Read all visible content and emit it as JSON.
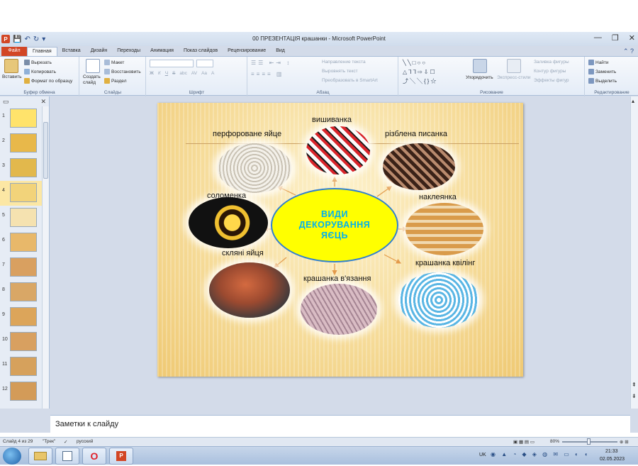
{
  "window": {
    "title": "00 ПРЕЗЕНТАЦІЯ крашанки - Microsoft PowerPoint",
    "app_letter": "P",
    "controls": [
      "—",
      "❐",
      "✕"
    ]
  },
  "tabs": {
    "file": "Файл",
    "items": [
      "Главная",
      "Вставка",
      "Дизайн",
      "Переходы",
      "Анимация",
      "Показ слайдов",
      "Рецензирование",
      "Вид"
    ]
  },
  "ribbon": {
    "clipboard": {
      "paste": "Вставить",
      "cut": "Вырезать",
      "copy": "Копировать",
      "format_painter": "Формат по образцу",
      "name": "Буфер обмена"
    },
    "slides": {
      "new_slide": "Создать слайд",
      "layout": "Макет",
      "reset": "Восстановить",
      "section": "Раздел",
      "name": "Слайды"
    },
    "font": {
      "name": "Шрифт",
      "bold": "Ж",
      "italic": "К",
      "underline": "Ч",
      "strike": "S",
      "shadow": "abc",
      "spacing": "AV",
      "case": "Aa",
      "color": "A"
    },
    "paragraph": {
      "direction": "Направление текста",
      "align": "Выровнять текст",
      "smartart": "Преобразовать в SmartArt",
      "name": "Абзац"
    },
    "drawing": {
      "shapes": "╲╲□○○\n△⅂⅂⇨⇩☐\n⤴╲╲{}☆",
      "arrange": "Упорядочить",
      "quick_styles": "Экспресс-стили",
      "fill": "Заливка фигуры",
      "outline": "Контур фигуры",
      "effects": "Эффекты фигур",
      "name": "Рисование"
    },
    "editing": {
      "find": "Найти",
      "replace": "Заменить",
      "select": "Выделить",
      "name": "Редактирование"
    }
  },
  "thumbnails": {
    "numbers": [
      "1",
      "2",
      "3",
      "4",
      "5",
      "6",
      "7",
      "8",
      "9",
      "10",
      "11",
      "12"
    ],
    "selected": 4,
    "colors": [
      "#ffe36b",
      "#e8b84a",
      "#e2b84c",
      "#f2d37a",
      "#f5e2b0",
      "#e8b86a",
      "#d9a060",
      "#d9a766",
      "#dca55a",
      "#d8a060",
      "#d6a15c",
      "#d39b58"
    ]
  },
  "slide": {
    "center_title": [
      "ВИДИ",
      "ДЕКОРУВАННЯ",
      "ЯЄЦЬ"
    ],
    "labels": {
      "perforated": "перфороване яйце",
      "embroidered": "вишиванка",
      "carved": "різблена писанка",
      "straw": "соломенка",
      "sticker": "наклеянка",
      "glass": "скляні яйця",
      "quilling": "крашанка квілінг",
      "knitted": "крашанка в'язання"
    }
  },
  "notes": {
    "placeholder": "Заметки к слайду"
  },
  "status": {
    "slide_info": "Слайд 4 из 29",
    "theme": "\"Трек\"",
    "language": "русский",
    "zoom": "80%"
  },
  "taskbar": {
    "lang": "UK",
    "time": "21:33",
    "date": "02.05.2023"
  },
  "colors": {
    "file_tab": "#d24625",
    "center_fill": "#ffff00",
    "center_text": "#00b0f0",
    "arrow": "#e39a4a"
  }
}
